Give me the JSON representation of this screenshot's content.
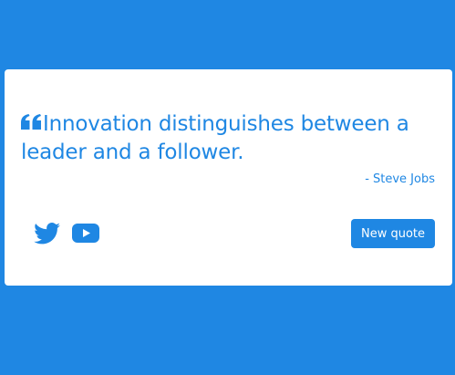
{
  "quote_box": {
    "quote_icon": "quote-left-icon",
    "text": "Innovation distinguishes between a leader and a follower.",
    "author": "- Steve Jobs"
  },
  "social": {
    "twitter_icon": "twitter-icon",
    "youtube_icon": "youtube-icon"
  },
  "actions": {
    "new_quote_label": "New quote"
  },
  "colors": {
    "background": "#1f87e3",
    "accent": "#1f87e3",
    "card": "#ffffff"
  }
}
